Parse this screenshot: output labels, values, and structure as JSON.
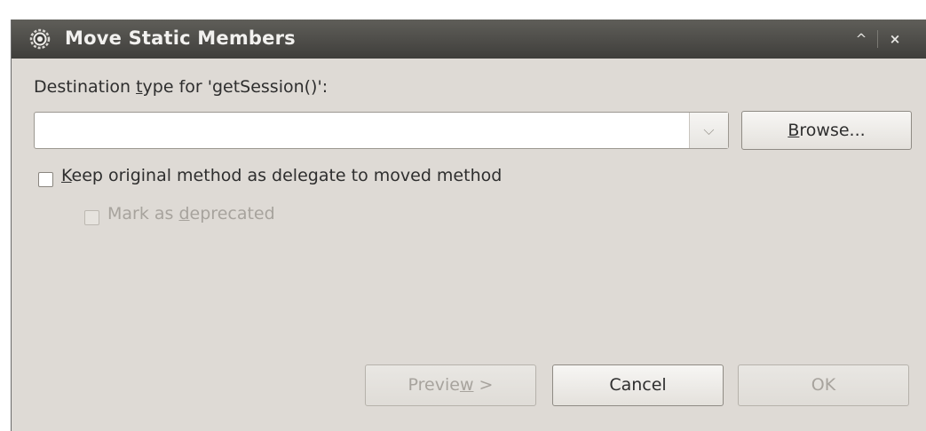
{
  "dialog": {
    "title": "Move Static Members",
    "title_icon": "eclipse-gear-icon",
    "maximize_glyph": "^",
    "close_glyph": "×"
  },
  "destination": {
    "label_pre": "Destination ",
    "label_mnemonic": "t",
    "label_post": "ype for 'getSession()':",
    "value": "",
    "dropdown_icon": "chevron-down-icon",
    "dropdown_glyph": "⌵"
  },
  "browse": {
    "mnemonic": "B",
    "label_post": "rowse..."
  },
  "keep_delegate": {
    "checked": false,
    "mnemonic": "K",
    "label_post": "eep original method as delegate to moved method"
  },
  "mark_deprecated": {
    "checked": false,
    "enabled": false,
    "label_pre": "Mark as ",
    "mnemonic": "d",
    "label_post": "eprecated"
  },
  "buttons": {
    "preview_pre": "Previe",
    "preview_mnemonic": "w",
    "preview_post": " >",
    "cancel": "Cancel",
    "ok": "OK"
  }
}
